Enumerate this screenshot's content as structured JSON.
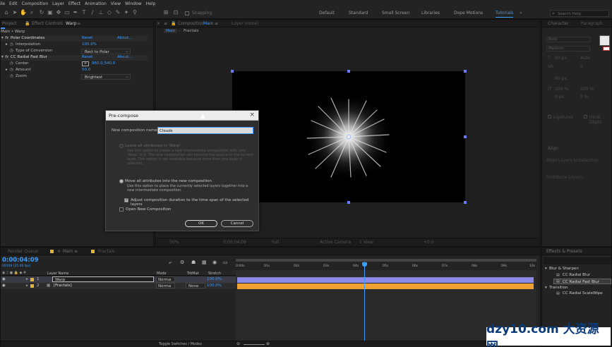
{
  "menu": [
    "ile",
    "Edit",
    "Composition",
    "Layer",
    "Effect",
    "Animation",
    "View",
    "Window",
    "Help"
  ],
  "toolbar": {
    "snapping": "Snapping",
    "workspaces": [
      "Default",
      "Standard",
      "Small Screen",
      "Libraries",
      "Dope Motions",
      "Tutorials"
    ],
    "active_workspace": "Tutorials",
    "search_placeholder": "Search Help"
  },
  "effects_panel": {
    "tab_project": "Project",
    "tab_effect_controls": "Effect Controls",
    "tab_layer": "Warp",
    "breadcrumb": "Main • Warp",
    "effects": [
      {
        "name": "Polar Coordinates",
        "reset": "Reset",
        "about": "About...",
        "props": [
          {
            "name": "Interpolation",
            "value": "100.0%"
          },
          {
            "name": "Type of Conversion",
            "value": "Rect to Polar"
          }
        ]
      },
      {
        "name": "CC Radial Fast Blur",
        "reset": "Reset",
        "about": "About...",
        "props": [
          {
            "name": "Center",
            "value": "960.0,540.0"
          },
          {
            "name": "Amount",
            "value": "50.0"
          },
          {
            "name": "Zoom",
            "value": "Brightest"
          }
        ]
      }
    ]
  },
  "composition_panel": {
    "tab_label": "Composition",
    "tab_name": "Main",
    "layer_tab": "Layer (none)",
    "breadcrumbs": [
      "Main",
      "Fractals"
    ],
    "zoom": "50%",
    "timecode": "0:00:04:09",
    "resolution": "Full",
    "camera": "Active Camera",
    "views": "1 View",
    "exposure": "+0.0"
  },
  "dialog": {
    "title": "Pre-compose",
    "name_label": "New composition name:",
    "name_value": "Clouds",
    "option1_label": "Leave all attributes in 'Warp'",
    "option1_desc": "Use this option to create a new intermediate composition with only 'Warp' in it. The new composition will become the source to the current layer. This option is not available because more than one layer is selected.",
    "option2_label": "Move all attributes into the new composition",
    "option2_desc": "Use this option to place the currently selected layers together into a new intermediate composition.",
    "adjust_label": "Adjust composition duration to the time span of the selected layers",
    "open_label": "Open New Composition",
    "ok": "OK",
    "cancel": "Cancel"
  },
  "right_panel": {
    "tab_character": "Character",
    "tab_paragraph": "Paragraph",
    "font": "Bold",
    "style": "Medium",
    "size": "60 px",
    "leading": "Auto",
    "tracking": "0",
    "tsume": "0 %",
    "vscale": "100 %",
    "hscale": "100 %",
    "baseline": "0 px",
    "ligatures": "Ligatures",
    "hindi_digits": "Hindi Digits",
    "align_title": "Align",
    "align_to_label": "Align Layers to:",
    "align_to_value": "Selection",
    "distribute_label": "Distribute Layers:"
  },
  "effects_presets": {
    "title": "Effects & Presets",
    "groups": [
      {
        "name": "Blur & Sharpen",
        "items": [
          "CC Radial Blur",
          "CC Radial Fast Blur"
        ],
        "selected": "CC Radial Fast Blur"
      },
      {
        "name": "Transition",
        "items": [
          "CC Radial ScaleWipe"
        ]
      }
    ]
  },
  "timeline": {
    "tab_render": "Render Queue",
    "tab_main": "Main",
    "tab_fractals": "Fractals",
    "timecode": "0:00:04:09",
    "frame": "00109 (25.00 fps)",
    "col_layer_name": "Layer Name",
    "col_mode": "Mode",
    "col_trkmat": "TrkMat",
    "col_stretch": "Stretch",
    "layers": [
      {
        "num": "1",
        "name": "Warp",
        "mode": "Norma",
        "trkmat": "",
        "stretch": "100.0%",
        "color": "#e0b43a"
      },
      {
        "num": "2",
        "name": "[Fractals]",
        "mode": "Norma",
        "trkmat": "None",
        "stretch": "100.0%",
        "color": "#e0b43a"
      }
    ],
    "ruler": [
      "0:00s",
      "01s",
      "02s",
      "03s",
      "04s",
      "05s",
      "06s",
      "07s",
      "08s",
      "09s",
      "10s"
    ],
    "toggle_label": "Toggle Switches / Modes"
  },
  "watermark": "dzy10.com 大资源网",
  "colors": {
    "accent": "#3b9cff",
    "track_purple": "#8a8ae6",
    "track_orange": "#f0a030",
    "panel": "#232323"
  }
}
